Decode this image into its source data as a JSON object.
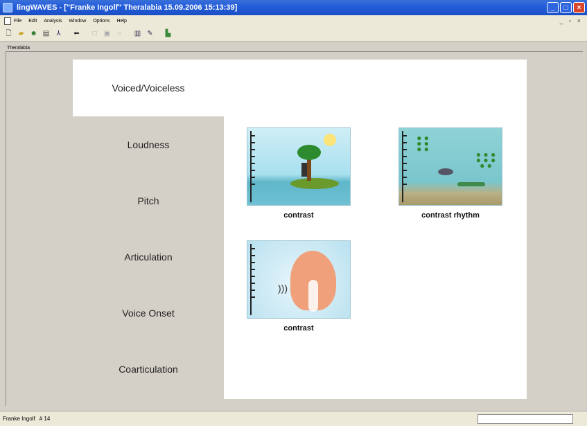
{
  "window": {
    "title": "lingWAVES - [\"Franke Ingolf\" Theralabia 15.09.2006 15:13:39]",
    "controls": [
      "_",
      "□",
      "×"
    ]
  },
  "menu": {
    "items": [
      "File",
      "Edit",
      "Analysis",
      "Window",
      "Options",
      "Help"
    ],
    "mdi_controls": "_ ▫ ×"
  },
  "toolbar": {
    "icons": [
      "new-icon",
      "open-icon",
      "user-icon",
      "print-icon",
      "tool-icon",
      "back-arrow-icon",
      "square-icon",
      "record-icon",
      "circle-icon",
      "chart-icon",
      "edit-icon",
      "bars-icon"
    ]
  },
  "document": {
    "label": "Theralabia"
  },
  "nav": {
    "items": [
      {
        "label": "Voiced/Voiceless",
        "selected": true
      },
      {
        "label": "Loudness",
        "selected": false
      },
      {
        "label": "Pitch",
        "selected": false
      },
      {
        "label": "Articulation",
        "selected": false
      },
      {
        "label": "Voice Onset",
        "selected": false
      },
      {
        "label": "Coarticulation",
        "selected": false
      }
    ]
  },
  "exercises": [
    {
      "label": "contrast",
      "image": "island-scene"
    },
    {
      "label": "contrast rhythm",
      "image": "underwater-scene"
    },
    {
      "label": "contrast",
      "image": "head-profile-scene"
    }
  ],
  "status": {
    "user": "Franke Ingolf",
    "count": "# 14"
  }
}
